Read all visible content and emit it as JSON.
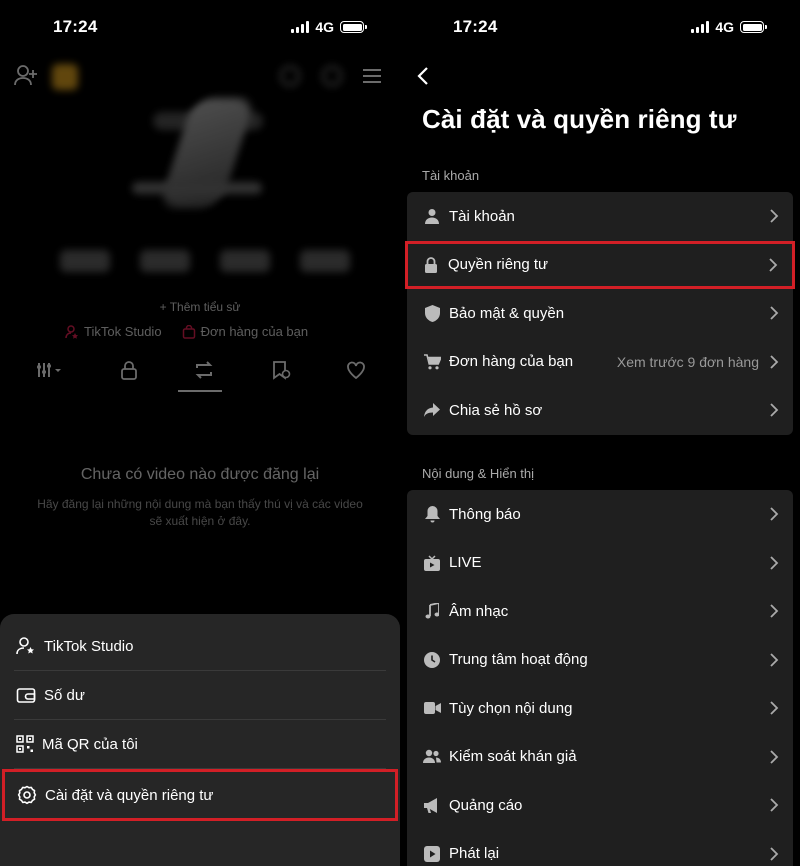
{
  "status": {
    "time": "17:24",
    "network": "4G"
  },
  "left": {
    "add_bio": "+ Thêm tiểu sử",
    "studio_link": "TikTok Studio",
    "orders_link": "Đơn hàng của bạn",
    "empty_title": "Chưa có video nào được đăng lại",
    "empty_desc": "Hãy đăng lại những nội dung mà bạn thấy thú vị và các video sẽ xuất hiện ở đây.",
    "sheet_items": [
      {
        "label": "TikTok Studio",
        "icon": "user-star-icon"
      },
      {
        "label": "Số dư",
        "icon": "wallet-icon"
      },
      {
        "label": "Mã QR của tôi",
        "icon": "qr-code-icon"
      },
      {
        "label": "Cài đặt và quyền riêng tư",
        "icon": "gear-icon",
        "highlighted": true
      }
    ]
  },
  "right": {
    "title": "Cài đặt và quyền riêng tư",
    "section1": "Tài khoản",
    "section2": "Nội dung & Hiển thị",
    "account_rows": [
      {
        "label": "Tài khoản",
        "icon": "person-icon"
      },
      {
        "label": "Quyền riêng tư",
        "icon": "lock-icon",
        "highlighted": true
      },
      {
        "label": "Bảo mật & quyền",
        "icon": "shield-icon"
      },
      {
        "label": "Đơn hàng của bạn",
        "icon": "cart-icon",
        "extra": "Xem trước 9 đơn hàng"
      },
      {
        "label": "Chia sẻ hồ sơ",
        "icon": "share-icon"
      }
    ],
    "content_rows": [
      {
        "label": "Thông báo",
        "icon": "bell-icon"
      },
      {
        "label": "LIVE",
        "icon": "tv-icon"
      },
      {
        "label": "Âm nhạc",
        "icon": "music-icon"
      },
      {
        "label": "Trung tâm hoạt động",
        "icon": "clock-icon"
      },
      {
        "label": "Tùy chọn nội dung",
        "icon": "video-icon"
      },
      {
        "label": "Kiểm soát khán giả",
        "icon": "audience-icon"
      },
      {
        "label": "Quảng cáo",
        "icon": "megaphone-icon"
      },
      {
        "label": "Phát lại",
        "icon": "play-icon"
      }
    ]
  },
  "colors": {
    "highlight": "#d21f26",
    "group_bg": "#1f1f1f",
    "sheet_bg": "#262626"
  }
}
